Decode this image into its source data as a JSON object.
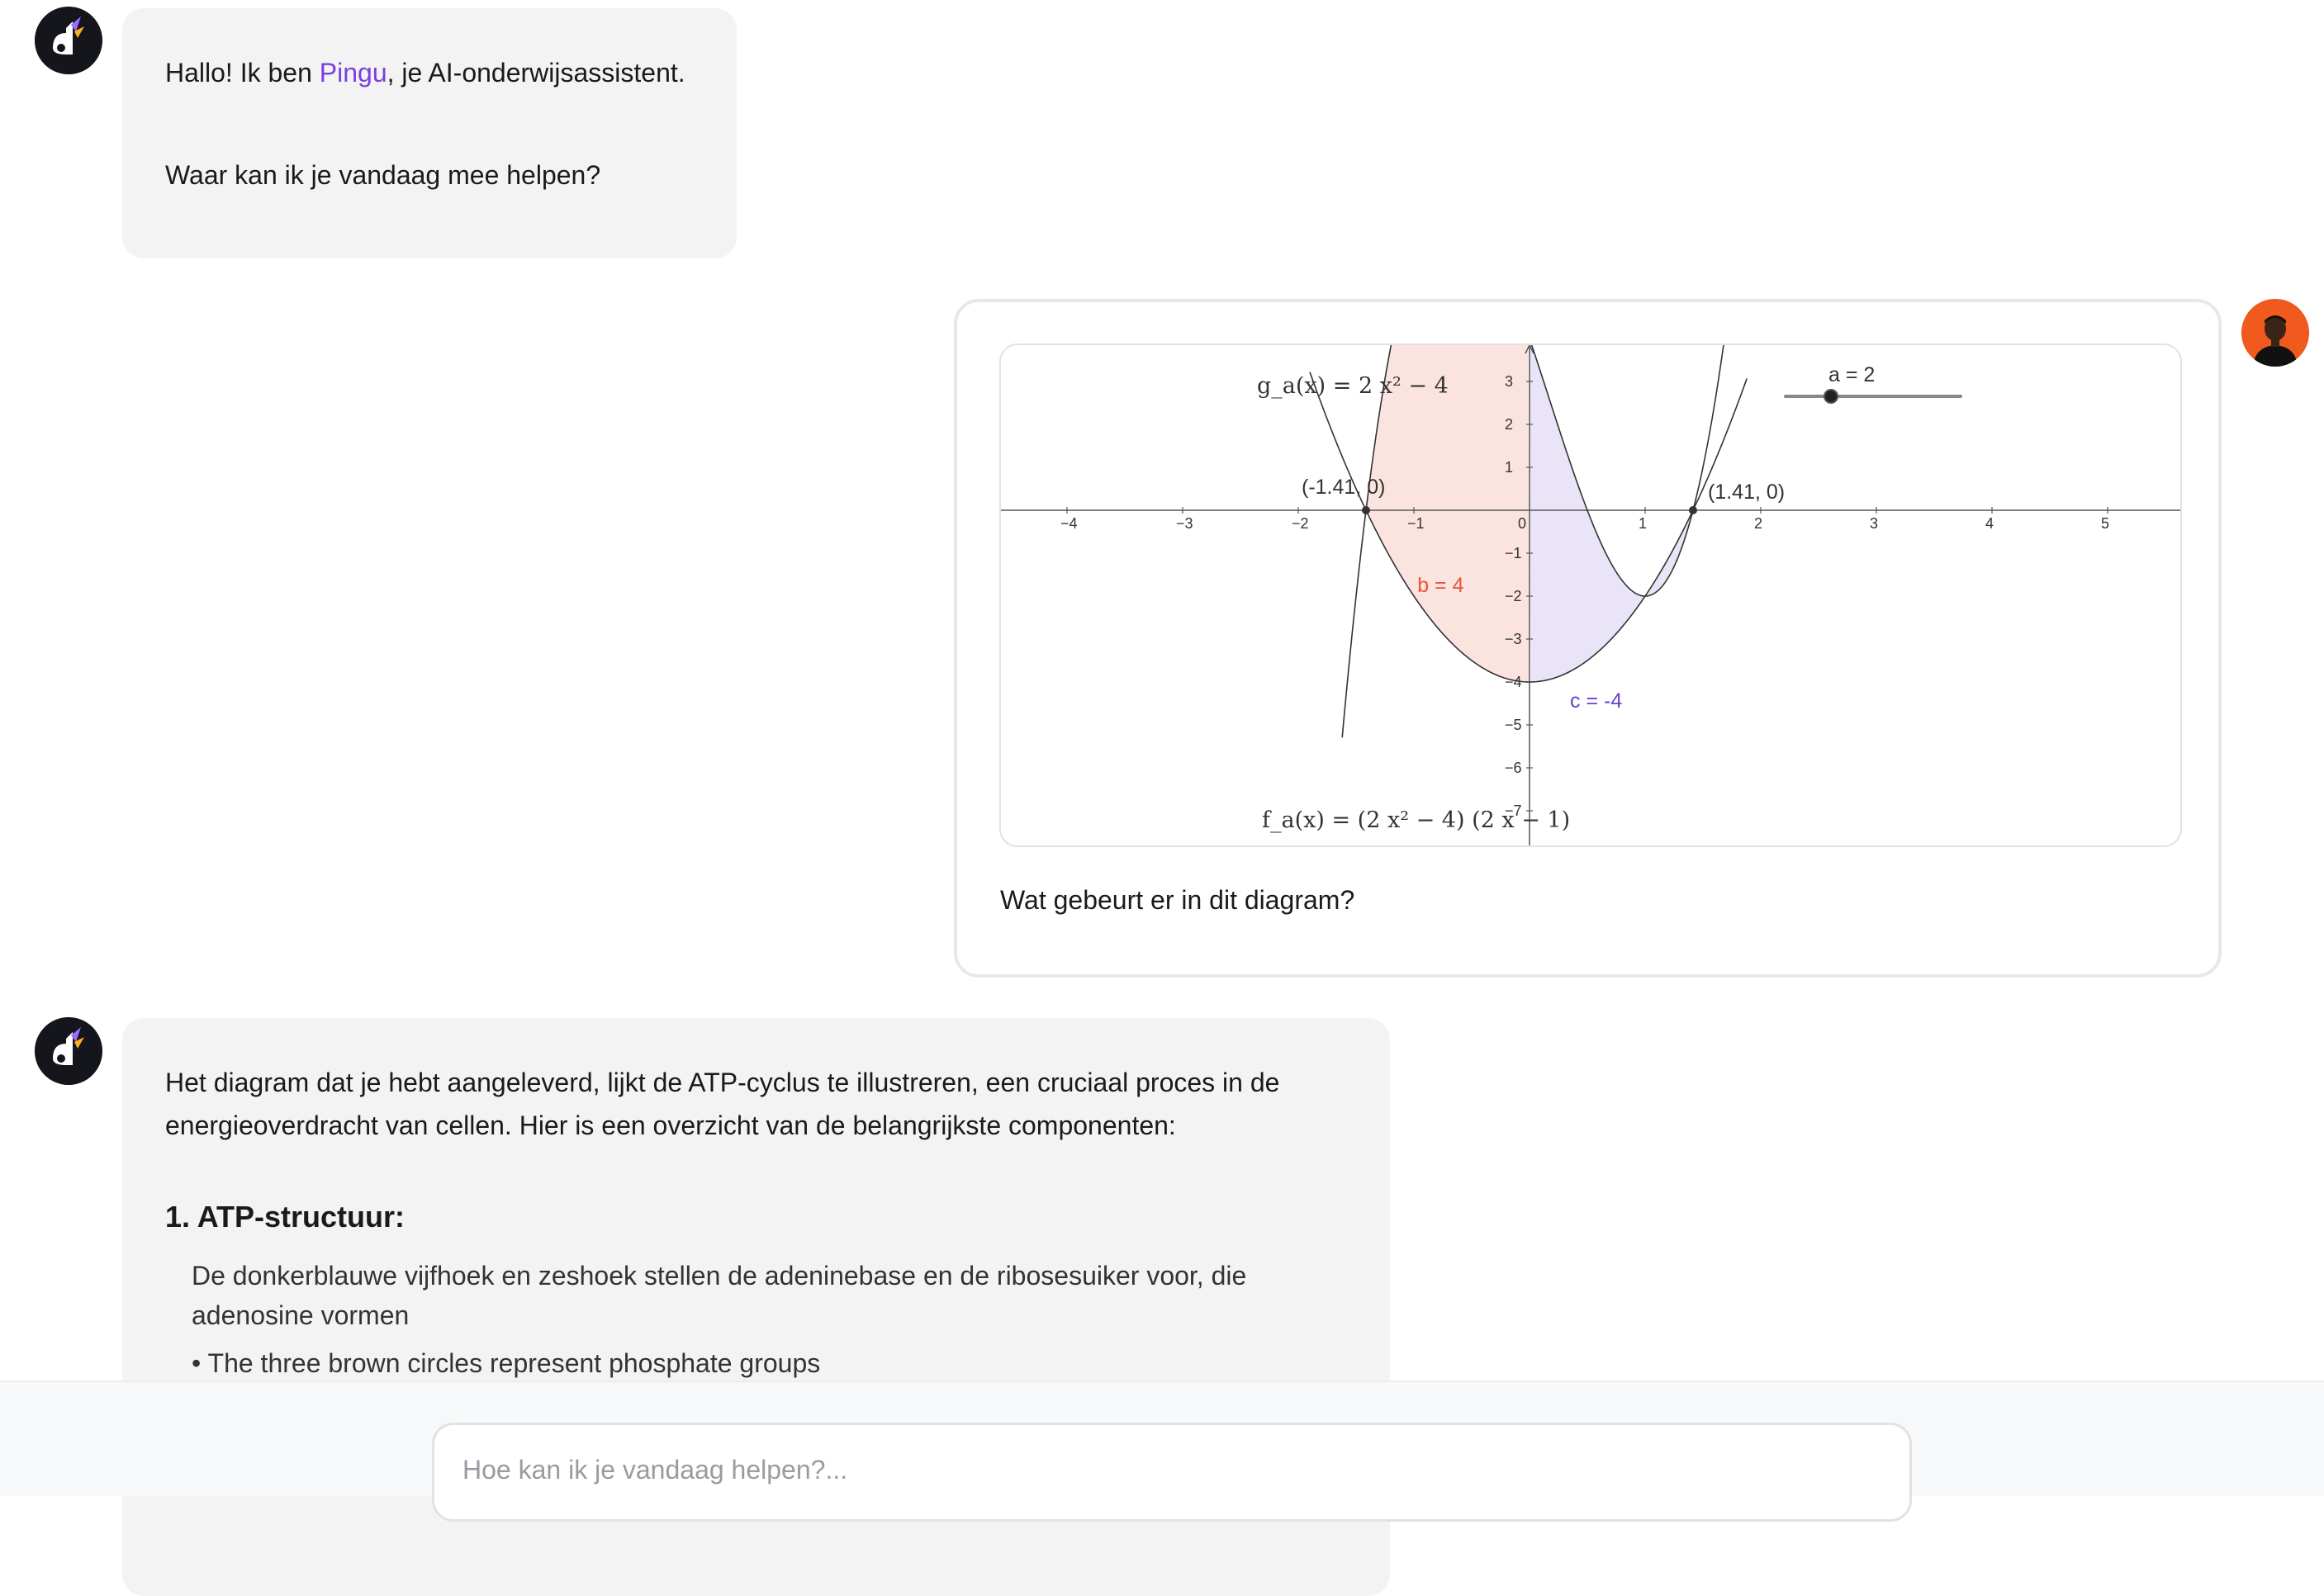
{
  "assistant_message_1": {
    "greeting_prefix": "Hallo! Ik ben ",
    "assistant_name": "Pingu",
    "greeting_suffix": ", je AI-onderwijsassistent.",
    "question": "Waar kan ik je vandaag mee helpen?"
  },
  "user_message": {
    "text": "Wat gebeurt er in dit diagram?",
    "attachment": {
      "g_label": "g_a(x) = 2 x² − 4",
      "f_label": "f_a(x) = (2 x² − 4) (2 x − 1)",
      "slider_label": "a = 2",
      "slider_value": 2,
      "point_left_label": "(-1.41, 0)",
      "point_right_label": "(1.41, 0)",
      "area_b_label": "b = 4",
      "area_c_label": "c = -4",
      "x_ticks": [
        "−4",
        "−3",
        "−2",
        "−1",
        "0",
        "1",
        "2",
        "3",
        "4",
        "5"
      ],
      "y_ticks": [
        "3",
        "2",
        "1",
        "−1",
        "−2",
        "−3",
        "−4",
        "−5",
        "−6",
        "−7"
      ]
    }
  },
  "assistant_message_2": {
    "lead": "Het diagram dat je hebt aangeleverd, lijkt de ATP-cyclus te illustreren, een cruciaal proces in de energieoverdracht van cellen. Hier is een overzicht van de belangrijkste componenten:",
    "heading": "1. ATP-structuur:",
    "detail": "De donkerblauwe vijfhoek en zeshoek stellen de adeninebase en de ribosesuiker voor, die adenosine vormen",
    "bullet": "The three brown circles represent phosphate groups"
  },
  "composer": {
    "placeholder": "Hoe kan ik je vandaag helpen?..."
  },
  "colors": {
    "accent": "#7a3fe0",
    "area_b": "#e8543a",
    "area_c": "#6a3fd6",
    "user_avatar_bg": "#f05a1e",
    "bot_avatar_bg": "#15161c"
  }
}
